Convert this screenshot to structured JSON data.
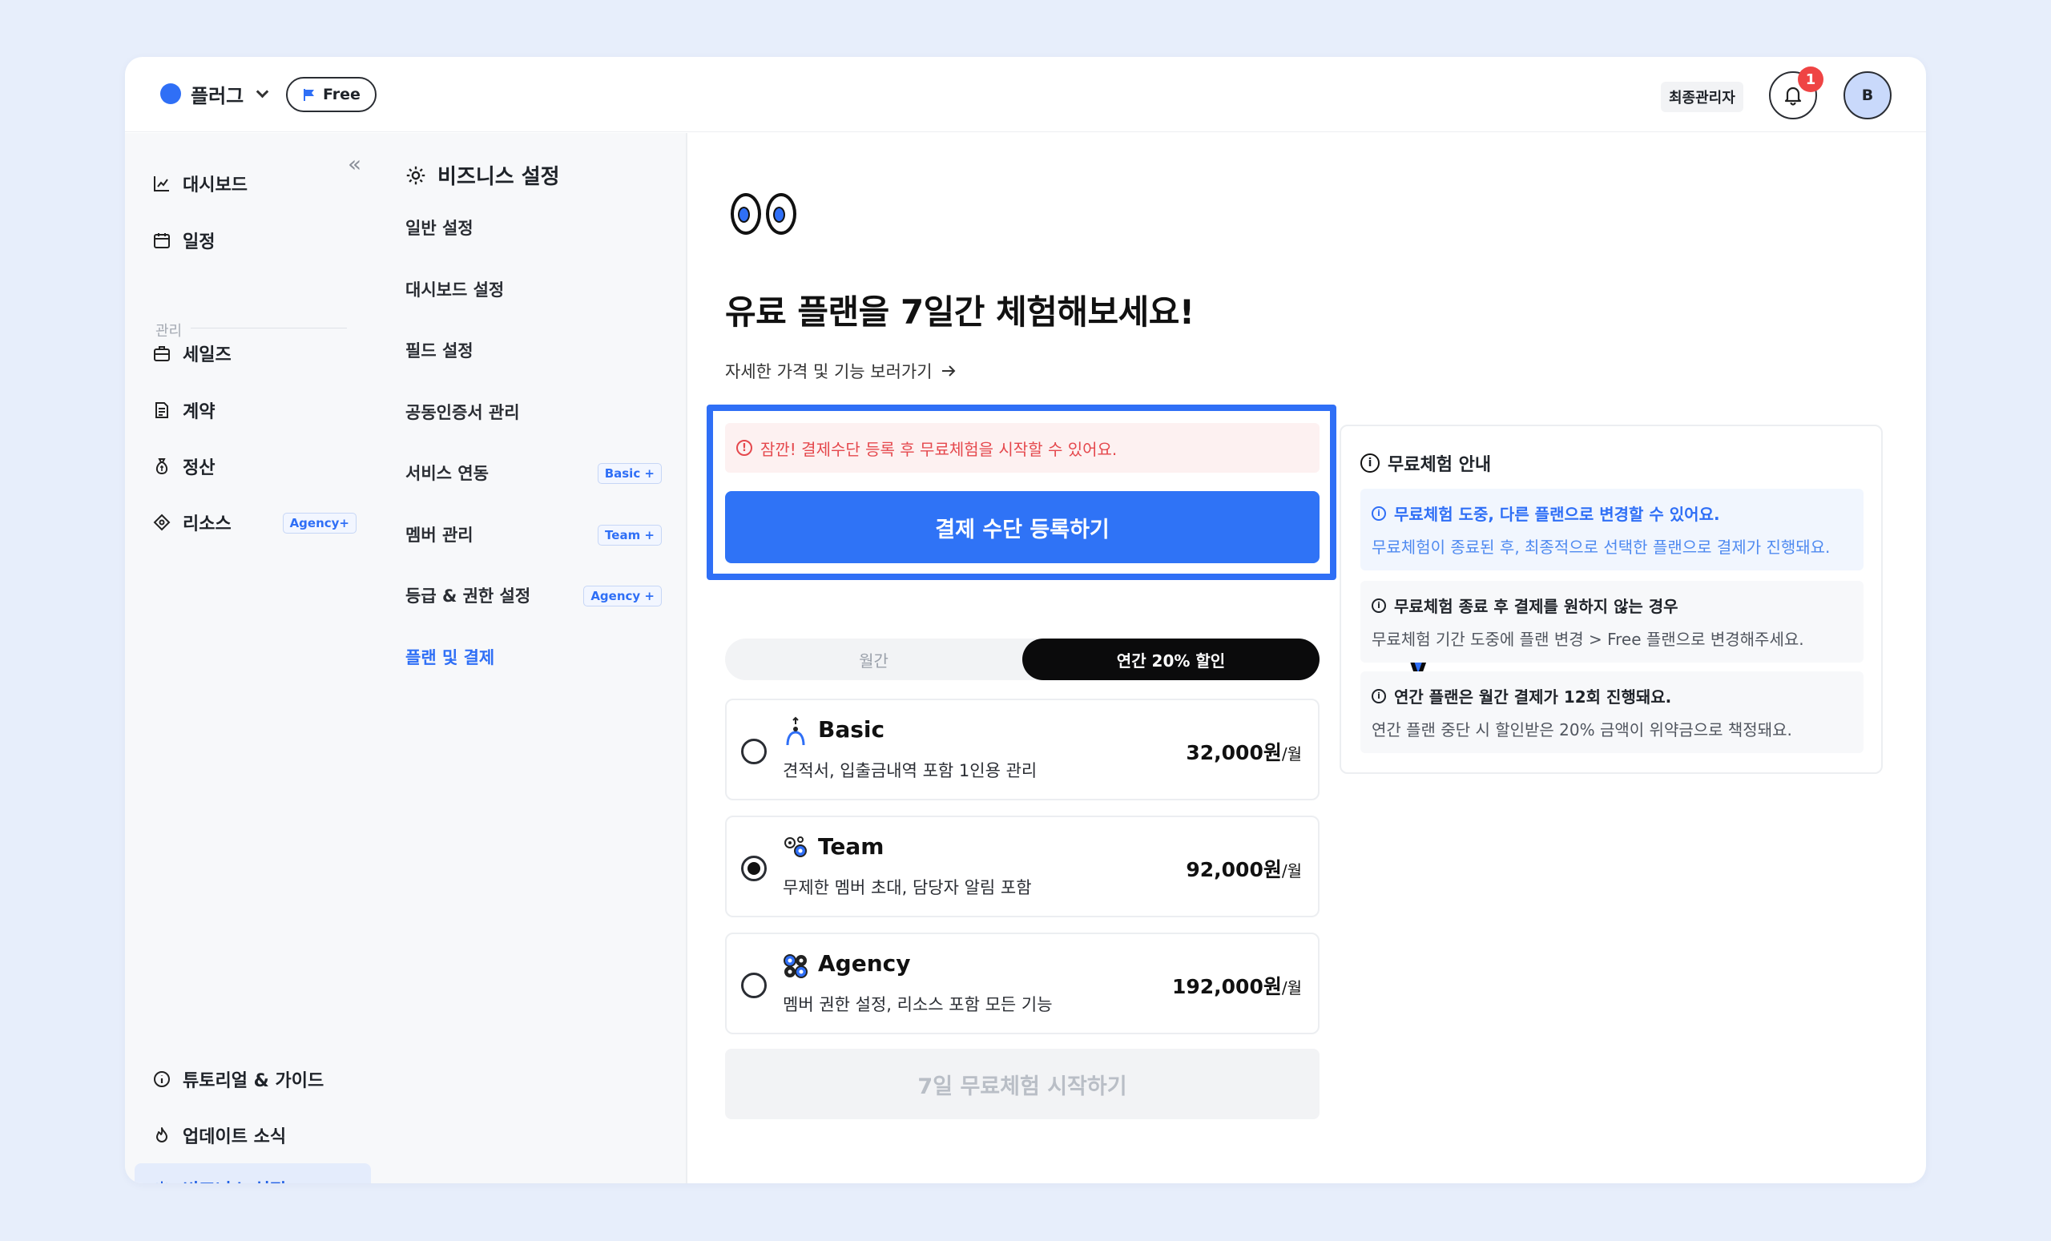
{
  "header": {
    "workspace_name": "플러그",
    "plan_pill": "Free",
    "role_label": "최종관리자",
    "notification_count": "1",
    "avatar_initial": "B"
  },
  "sidebar": {
    "section_label": "관리",
    "items": [
      {
        "label": "대시보드",
        "icon": "chart-icon"
      },
      {
        "label": "일정",
        "icon": "calendar-icon"
      },
      {
        "label": "세일즈",
        "icon": "briefcase-icon"
      },
      {
        "label": "계약",
        "icon": "document-icon"
      },
      {
        "label": "정산",
        "icon": "money-bag-icon"
      },
      {
        "label": "리소스",
        "icon": "puzzle-icon",
        "badge": "Agency+"
      }
    ],
    "bottom_items": [
      {
        "label": "튜토리얼 & 가이드",
        "icon": "info-icon"
      },
      {
        "label": "업데이트 소식",
        "icon": "fire-icon"
      },
      {
        "label": "비즈니스 설정",
        "icon": "gear-icon",
        "active": true
      }
    ]
  },
  "settings_nav": {
    "title": "비즈니스 설정",
    "items": [
      {
        "label": "일반 설정"
      },
      {
        "label": "대시보드 설정"
      },
      {
        "label": "필드 설정"
      },
      {
        "label": "공동인증서 관리"
      },
      {
        "label": "서비스 연동",
        "badge": "Basic +"
      },
      {
        "label": "멤버 관리",
        "badge": "Team +"
      },
      {
        "label": "등급 & 권한 설정",
        "badge": "Agency +"
      },
      {
        "label": "플랜 및 결제",
        "active": true
      }
    ]
  },
  "main": {
    "headline": "유료 플랜을 7일간 체험해보세요!",
    "more_link": "자세한 가격 및 기능 보러가기",
    "warning": "잠깐! 결제수단 등록 후 무료체험을 시작할 수 있어요.",
    "pay_button": "결제 수단 등록하기",
    "toggle": {
      "monthly": "월간",
      "yearly": "연간 20% 할인",
      "selected": "yearly"
    },
    "plans": [
      {
        "name": "Basic",
        "desc": "견적서, 입출금내역 포함 1인용 관리",
        "price": "32,000원",
        "unit": "/월",
        "selected": false
      },
      {
        "name": "Team",
        "desc": "무제한 멤버 초대, 담당자 알림 포함",
        "price": "92,000원",
        "unit": "/월",
        "selected": true
      },
      {
        "name": "Agency",
        "desc": "멤버 권한 설정, 리소스 포함 모든 기능",
        "price": "192,000원",
        "unit": "/월",
        "selected": false
      }
    ],
    "start_button": "7일 무료체험 시작하기"
  },
  "info_panel": {
    "title": "무료체험 안내",
    "cards": [
      {
        "title": "무료체험 도중, 다른 플랜으로 변경할 수 있어요.",
        "body": "무료체험이 종료된 후, 최종적으로 선택한 플랜으로 결제가 진행돼요."
      },
      {
        "title": "무료체험 종료 후 결제를 원하지 않는 경우",
        "body": "무료체험 기간 도중에 플랜 변경 > Free 플랜으로 변경해주세요."
      },
      {
        "title": "연간 플랜은 월간 결제가 12회 진행돼요.",
        "body": "연간 플랜 중단 시 할인받은 20% 금액이 위약금으로 책정돼요."
      }
    ]
  },
  "colors": {
    "accent": "#2f73f6",
    "warning": "#e5484d",
    "badge": "#ef4444"
  }
}
